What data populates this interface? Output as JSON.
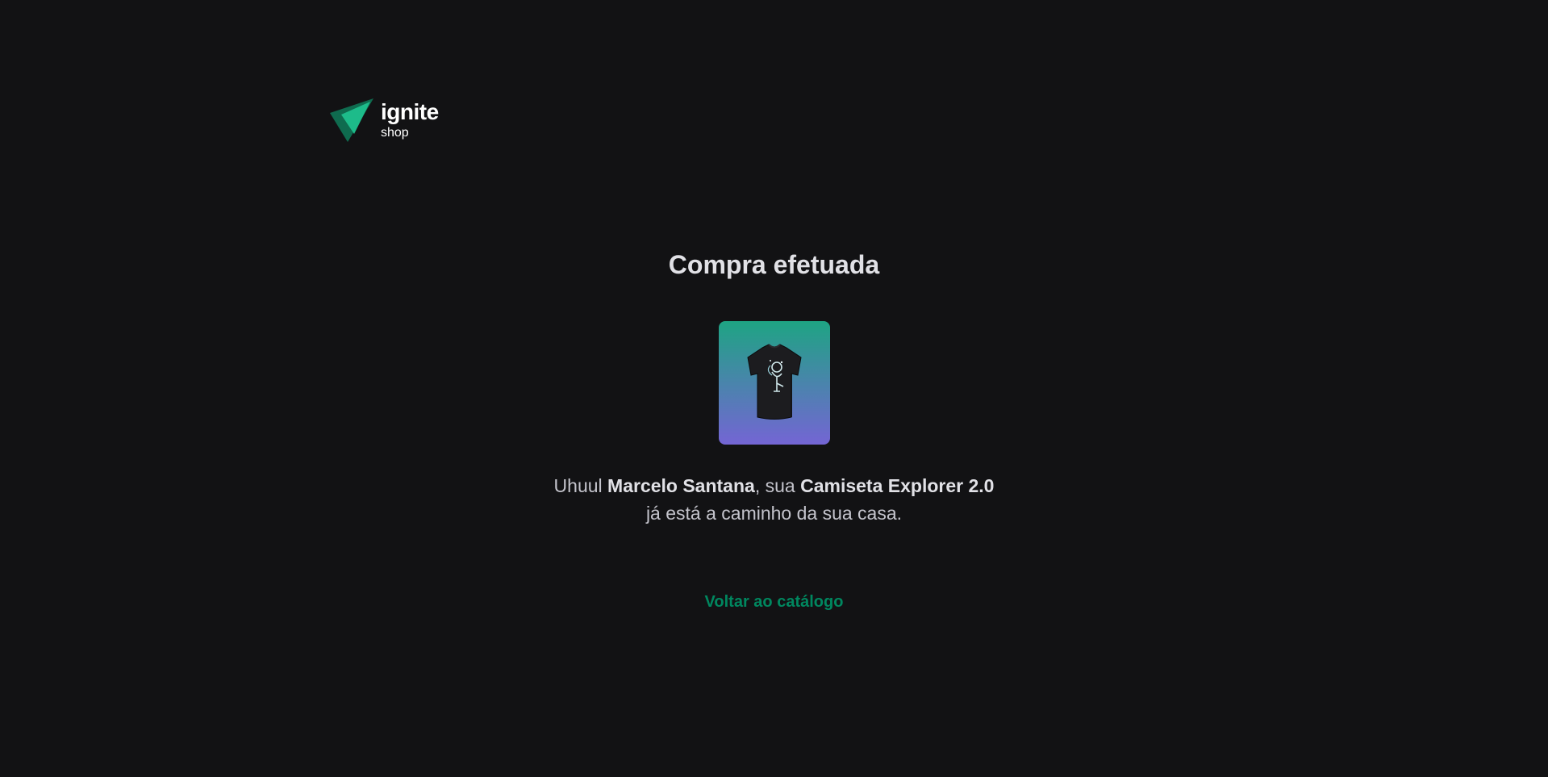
{
  "header": {
    "logo_word": "ignite",
    "logo_sub": "shop",
    "logo_colors": {
      "dark": "#0f6b4f",
      "light": "#1dbb8a"
    }
  },
  "success": {
    "title": "Compra efetuada",
    "product_image_alt": "Camiseta Explorer 2.0",
    "message": {
      "prefix": "Uhuul ",
      "customer_name": "Marcelo Santana",
      "middle": ", sua ",
      "product_name": "Camiseta Explorer 2.0",
      "suffix": "já está a caminho da sua casa."
    },
    "back_link": "Voltar ao catálogo"
  },
  "colors": {
    "background": "#121214",
    "accent": "#00875f",
    "gradient_top": "#1ea483",
    "gradient_bottom": "#7465d4"
  }
}
